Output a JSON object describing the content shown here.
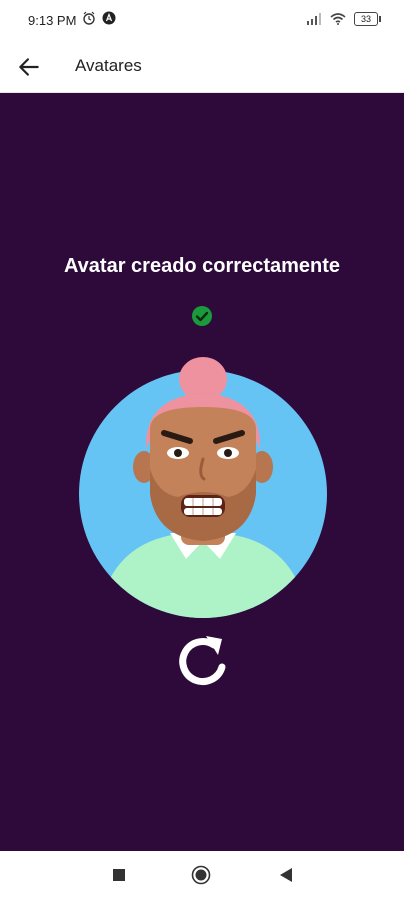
{
  "status_bar": {
    "time": "9:13 PM",
    "battery": "33",
    "icons": [
      "alarm-icon",
      "app-notification-icon",
      "signal-icon",
      "wifi-icon",
      "battery-icon"
    ]
  },
  "app_bar": {
    "title": "Avatares",
    "back_icon": "arrow-left-icon"
  },
  "main": {
    "headline": "Avatar creado correctamente",
    "badge_icon": "check-circle-icon",
    "avatar_image": "avatar-illustration",
    "refresh_icon": "refresh-icon"
  },
  "colors": {
    "content_background": "#2e0a3b",
    "avatar_circle": "#66c4f5",
    "hair": "#ee92a0",
    "skin": "#c4825a",
    "shirt": "#aef2c7",
    "check": "#1b9a3c"
  },
  "nav_bar": {
    "icons": [
      "recent-apps-icon",
      "home-icon",
      "back-triangle-icon"
    ]
  }
}
